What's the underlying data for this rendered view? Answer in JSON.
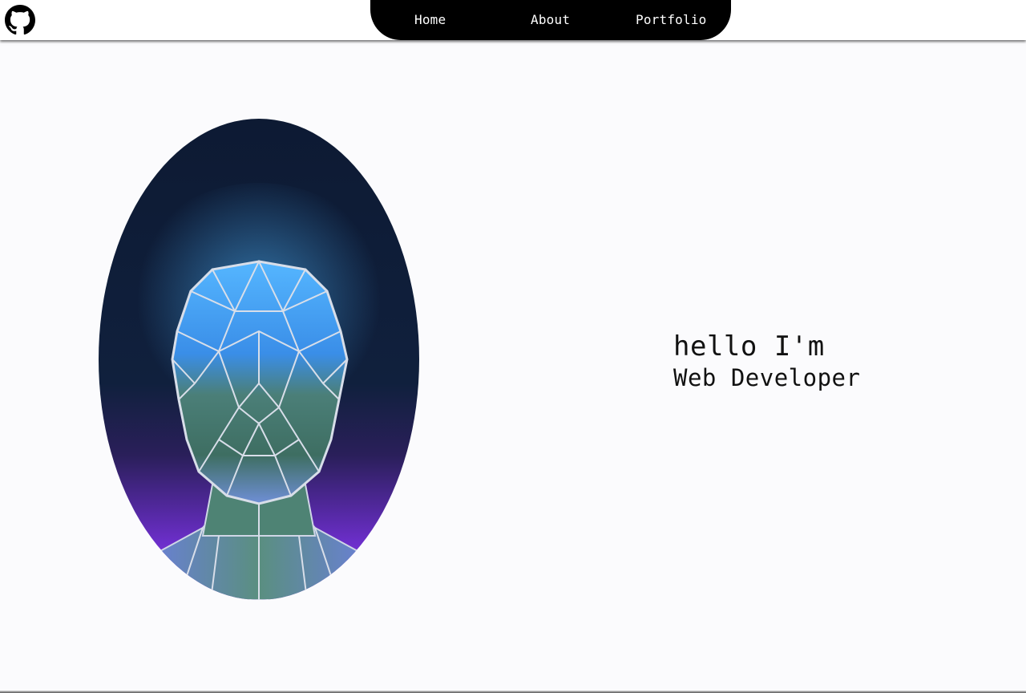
{
  "header": {
    "github_icon": "github-icon",
    "nav": {
      "home": "Home",
      "about": "About",
      "portfolio": "Portfolio"
    }
  },
  "hero": {
    "image_subject": "polygonal-glass-head",
    "greeting": "hello I'm",
    "role": "Web Developer"
  },
  "colors": {
    "nav_background": "#000000",
    "nav_text": "#ffffff",
    "page_background": "#fbfbfd",
    "accent_blue": "#3ba8ff",
    "accent_purple": "#9a3ff0"
  }
}
